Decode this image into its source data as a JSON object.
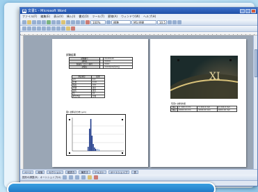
{
  "window": {
    "title": "文書1 - Microsoft Word",
    "app_icon": "W"
  },
  "menu": [
    "ファイル(F)",
    "編集(E)",
    "表示(V)",
    "挿入(I)",
    "書式(O)",
    "ツール(T)",
    "罫線(A)",
    "ウィンドウ(W)",
    "ヘルプ(H)"
  ],
  "toolbar": {
    "style": "標準",
    "font": "MS 明朝",
    "size": "10.5",
    "zoom": "100%"
  },
  "left_page": {
    "title": "試験結果",
    "table1": [
      [
        "試験番号",
        "",
        "XX-XXX-XX"
      ],
      [
        "試料名",
        "",
        "XXXXX"
      ],
      [
        "製品名・ロット番号",
        "",
        "XXXX"
      ],
      [
        "試験日",
        "",
        "XXXX年XX月XX日"
      ]
    ],
    "table2": [
      [
        "測定項目",
        "結果"
      ],
      [
        "pH",
        "X.X"
      ],
      [
        "比重",
        "X.XX"
      ],
      [
        "粘度",
        "XXX"
      ],
      [
        "外観",
        "適合"
      ],
      [
        "臭気",
        "適合"
      ],
      [
        "色",
        "XX"
      ],
      [
        "総合判定",
        "合格"
      ]
    ],
    "chart_label": "図1 試料の分布 (µm)"
  },
  "right_page": {
    "caption": "写真1 試料外観",
    "table3": [
      [
        "No.",
        "X: XXX.X mm",
        "Y: XXX.X mm",
        "Z: XXX.X mm"
      ],
      [
        "No.",
        "XXXX.XX mm",
        "XXXX.XX mm",
        "XXXX.XX mm"
      ]
    ]
  },
  "hbar": [
    "ページ",
    "段落",
    "セクション",
    "縦書き",
    "横書き",
    "テキスト",
    "オートシェイプ",
    "表",
    "図",
    "ワードアート"
  ],
  "drawbar": [
    "図形の調整(R)",
    "オートシェイプ(U)"
  ],
  "status": {
    "page": "1 ページ",
    "section": "1 セクション",
    "page_of": "1/2",
    "position": "位置 76mm",
    "line": "1 行",
    "col": "1 桁",
    "lang": "日本語"
  }
}
